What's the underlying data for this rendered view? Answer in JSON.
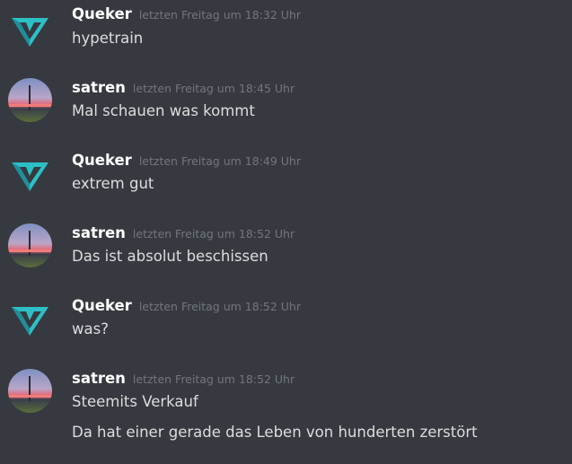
{
  "messages": [
    {
      "author": "Queker",
      "avatar": "gem-logo-icon",
      "timestamp": "letzten Freitag um 18:32 Uhr",
      "lines": [
        "hypetrain"
      ]
    },
    {
      "author": "satren",
      "avatar": "sunset-photo-icon",
      "timestamp": "letzten Freitag um 18:45 Uhr",
      "lines": [
        "Mal schauen was kommt"
      ]
    },
    {
      "author": "Queker",
      "avatar": "gem-logo-icon",
      "timestamp": "letzten Freitag um 18:49 Uhr",
      "lines": [
        "extrem gut"
      ]
    },
    {
      "author": "satren",
      "avatar": "sunset-photo-icon",
      "timestamp": "letzten Freitag um 18:52 Uhr",
      "lines": [
        "Das ist absolut beschissen"
      ]
    },
    {
      "author": "Queker",
      "avatar": "gem-logo-icon",
      "timestamp": "letzten Freitag um 18:52 Uhr",
      "lines": [
        "was?"
      ]
    },
    {
      "author": "satren",
      "avatar": "sunset-photo-icon",
      "timestamp": "letzten Freitag um 18:52 Uhr",
      "lines": [
        "Steemits Verkauf",
        "Da hat einer gerade das Leben von hunderten zerstört"
      ]
    }
  ],
  "colors": {
    "background": "#36393f",
    "author": "#ffffff",
    "timestamp": "#72767d",
    "text": "#dcddde",
    "gem": "#2dbfc6"
  }
}
